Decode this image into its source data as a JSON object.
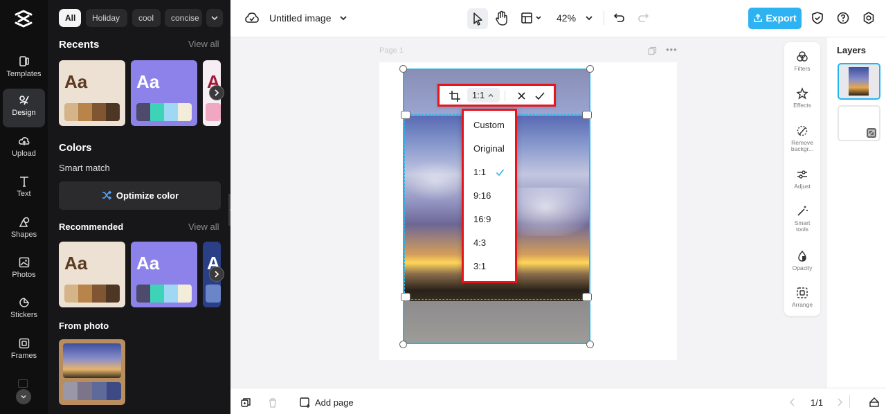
{
  "rail": {
    "items": [
      {
        "id": "templates",
        "label": "Templates"
      },
      {
        "id": "design",
        "label": "Design",
        "active": true
      },
      {
        "id": "upload",
        "label": "Upload"
      },
      {
        "id": "text",
        "label": "Text"
      },
      {
        "id": "shapes",
        "label": "Shapes"
      },
      {
        "id": "photos",
        "label": "Photos"
      },
      {
        "id": "stickers",
        "label": "Stickers"
      },
      {
        "id": "frames",
        "label": "Frames"
      }
    ]
  },
  "panel": {
    "chips": [
      "All",
      "Holiday",
      "cool",
      "concise"
    ],
    "recents_title": "Recents",
    "view_all": "View all",
    "colors_title": "Colors",
    "smart_match": "Smart match",
    "optimize": "Optimize color",
    "recommended_title": "Recommended",
    "from_photo": "From photo",
    "card_text": "Aa",
    "card_text_a": "A"
  },
  "topbar": {
    "doc_title": "Untitled image",
    "zoom": "42%",
    "export": "Export"
  },
  "canvas": {
    "page_label": "Page 1",
    "ratio": "1:1",
    "ratio_options": [
      "Custom",
      "Original",
      "1:1",
      "9:16",
      "16:9",
      "4:3",
      "3:1"
    ],
    "selected_ratio": "1:1"
  },
  "tools": [
    "Filters",
    "Effects",
    "Remove backgr...",
    "Adjust",
    "Smart tools",
    "Opacity",
    "Arrange"
  ],
  "layers": {
    "title": "Layers"
  },
  "bottom": {
    "add_page": "Add page",
    "page_count": "1/1"
  },
  "colors": {
    "accent": "#1fb6ee",
    "highlight": "#e8141c",
    "export_bg": "#2db3f2",
    "dark": "#17171a"
  }
}
